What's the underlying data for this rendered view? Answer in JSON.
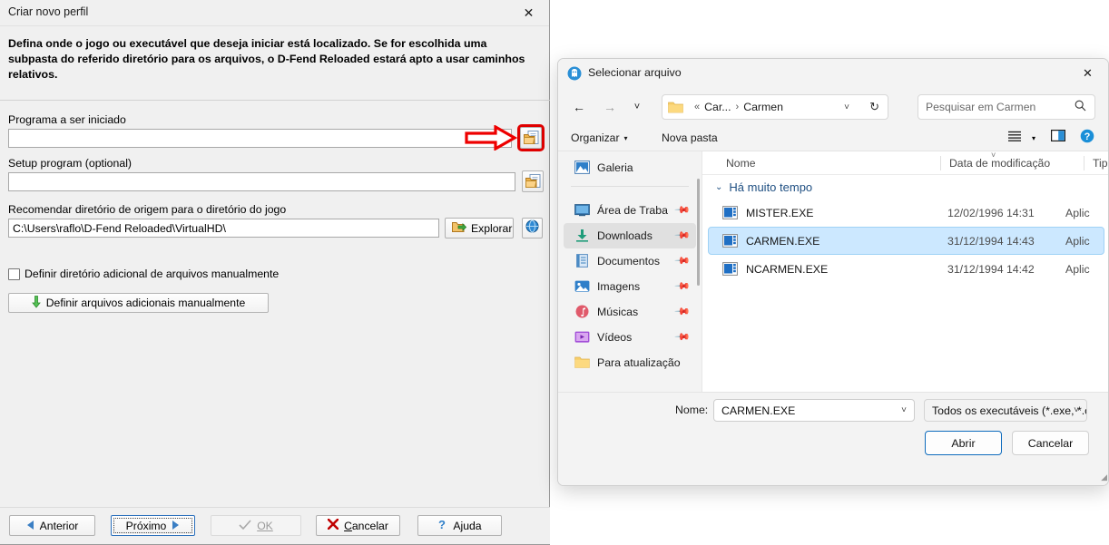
{
  "left_dialog": {
    "title": "Criar novo perfil",
    "close_icon": "close-icon",
    "intro": "Defina onde o jogo ou executável que deseja iniciar está localizado. Se for escolhida uma subpasta do referido diretório para os arquivos, o D-Fend Reloaded estará apto a usar caminhos relativos.",
    "program_label": "Programa a ser iniciado",
    "program_value": "",
    "program_browse_icon": "folder-document-icon",
    "setup_label": "Setup program (optional)",
    "setup_value": "",
    "setup_browse_icon": "folder-document-icon",
    "dir_label": "Recomendar diretório de origem para o diretório do jogo",
    "dir_value": "C:\\Users\\raflo\\D-Fend Reloaded\\VirtualHD\\",
    "explorar_label": "Explorar",
    "explorar_icon": "folder-arrow-icon",
    "globe_icon": "globe-help-icon",
    "checkbox_label": "Definir diretório adicional de arquivos manualmente",
    "checkbox_checked": false,
    "manual_files_label": "Definir arquivos adicionais manualmente",
    "manual_files_icon": "down-arrow-icon",
    "buttons": {
      "previous": "Anterior",
      "previous_icon": "left-triangle-icon",
      "next": "Próximo",
      "next_icon": "right-triangle-icon",
      "ok": "OK",
      "ok_icon": "check-icon",
      "ok_disabled": true,
      "cancel": "Cancelar",
      "cancel_icon": "x-mark-icon",
      "help": "Ajuda",
      "help_icon": "question-mark-icon"
    },
    "annotation": {
      "type": "red-right-arrow",
      "color": "#ee0000",
      "target": "program-browse-button"
    }
  },
  "file_dialog": {
    "title": "Selecionar arquivo",
    "app_icon": "dfend-app-icon",
    "close_icon": "close-icon",
    "nav": {
      "back_icon": "arrow-left-icon",
      "forward_icon": "arrow-right-icon",
      "recent_icon": "chevron-down-icon",
      "up_icon": "arrow-up-icon"
    },
    "breadcrumb": {
      "folder_icon": "folder-icon",
      "prefix": "«",
      "parent": "Car...",
      "separator": "›",
      "current": "Carmen",
      "dropdown_icon": "chevron-down-icon",
      "refresh_icon": "refresh-icon"
    },
    "search": {
      "placeholder": "Pesquisar em Carmen",
      "icon": "search-icon"
    },
    "toolbar": {
      "organize": "Organizar",
      "organize_caret": "▾",
      "new_folder": "Nova pasta",
      "view_icon": "list-view-icon",
      "view_caret": "▾",
      "pane_icon": "preview-pane-icon",
      "help_icon": "help-circle-icon"
    },
    "sidebar": {
      "items": [
        {
          "label": "Galeria",
          "icon": "gallery-icon",
          "pinned": false,
          "selected": false
        },
        {
          "label": "Área de Traba",
          "icon": "desktop-icon",
          "pinned": true,
          "selected": false
        },
        {
          "label": "Downloads",
          "icon": "downloads-icon",
          "pinned": true,
          "selected": true
        },
        {
          "label": "Documentos",
          "icon": "documents-icon",
          "pinned": true,
          "selected": false
        },
        {
          "label": "Imagens",
          "icon": "pictures-icon",
          "pinned": true,
          "selected": false
        },
        {
          "label": "Músicas",
          "icon": "music-icon",
          "pinned": true,
          "selected": false
        },
        {
          "label": "Vídeos",
          "icon": "videos-icon",
          "pinned": true,
          "selected": false
        },
        {
          "label": "Para atualização",
          "icon": "folder-icon",
          "pinned": false,
          "selected": false
        }
      ]
    },
    "columns": [
      "Nome",
      "Data de modificação",
      "Tipo"
    ],
    "group_header": "Há muito tempo",
    "group_caret": "⌄",
    "files": [
      {
        "name": "MISTER.EXE",
        "date": "12/02/1996 14:31",
        "type": "Aplic",
        "icon": "executable-icon",
        "selected": false
      },
      {
        "name": "CARMEN.EXE",
        "date": "31/12/1994 14:43",
        "type": "Aplic",
        "icon": "executable-icon",
        "selected": true
      },
      {
        "name": "NCARMEN.EXE",
        "date": "31/12/1994 14:42",
        "type": "Aplic",
        "icon": "executable-icon",
        "selected": false
      }
    ],
    "footer": {
      "name_label": "Nome:",
      "name_value": "CARMEN.EXE",
      "filter_value": "Todos os executáveis (*.exe, *.c",
      "open_button": "Abrir",
      "cancel_button": "Cancelar"
    }
  }
}
